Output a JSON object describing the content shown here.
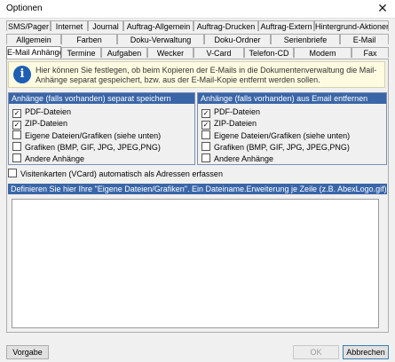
{
  "window": {
    "title": "Optionen"
  },
  "tabs": {
    "row1": [
      "SMS/Pager",
      "Internet",
      "Journal",
      "Auftrag-Allgemein",
      "Auftrag-Drucken",
      "Auftrag-Extern",
      "Hintergrund-Aktionen"
    ],
    "row2": [
      "Allgemein",
      "Farben",
      "Doku-Verwaltung",
      "Doku-Ordner",
      "Serienbriefe",
      "E-Mail"
    ],
    "row3": [
      "E-Mail Anhänge",
      "Termine",
      "Aufgaben",
      "Wecker",
      "V-Card",
      "Telefon-CD",
      "Modem",
      "Fax"
    ],
    "active": "E-Mail Anhänge"
  },
  "info": {
    "icon": "info-icon",
    "text": "Hier können Sie festlegen, ob beim Kopieren der E-Mails in die Dokumentenverwaltung die Mail-Anhänge separat gespeichert, bzw. aus der E-Mail-Kopie entfernt werden sollen."
  },
  "save_group": {
    "title": "Anhänge (falls vorhanden) separat speichern",
    "items": [
      {
        "label": "PDF-Dateien",
        "checked": true
      },
      {
        "label": "ZIP-Dateien",
        "checked": true
      },
      {
        "label": "Eigene Dateien/Grafiken (siehe unten)",
        "checked": false
      },
      {
        "label": "Grafiken (BMP, GIF, JPG, JPEG,PNG)",
        "checked": false
      },
      {
        "label": "Andere Anhänge",
        "checked": false
      }
    ]
  },
  "remove_group": {
    "title": "Anhänge (falls vorhanden) aus Email entfernen",
    "items": [
      {
        "label": "PDF-Dateien",
        "checked": true
      },
      {
        "label": "ZIP-Dateien",
        "checked": true
      },
      {
        "label": "Eigene Dateien/Grafiken (siehe unten)",
        "checked": false
      },
      {
        "label": "Grafiken (BMP, GIF, JPG, JPEG,PNG)",
        "checked": false
      },
      {
        "label": "Andere Anhänge",
        "checked": false
      }
    ]
  },
  "vcard": {
    "label": "Visitenkarten (VCard) automatisch als Adressen erfassen",
    "checked": false
  },
  "definitions": {
    "header": "Definieren Sie hier Ihre \"Eigene Dateien/Grafiken\". Ein Dateiname.Erweiterung je Zeile (z.B. AbexLogo.gif)",
    "value": ""
  },
  "buttons": {
    "vorgabe": "Vorgabe",
    "ok": "OK",
    "abbrechen": "Abbrechen"
  }
}
